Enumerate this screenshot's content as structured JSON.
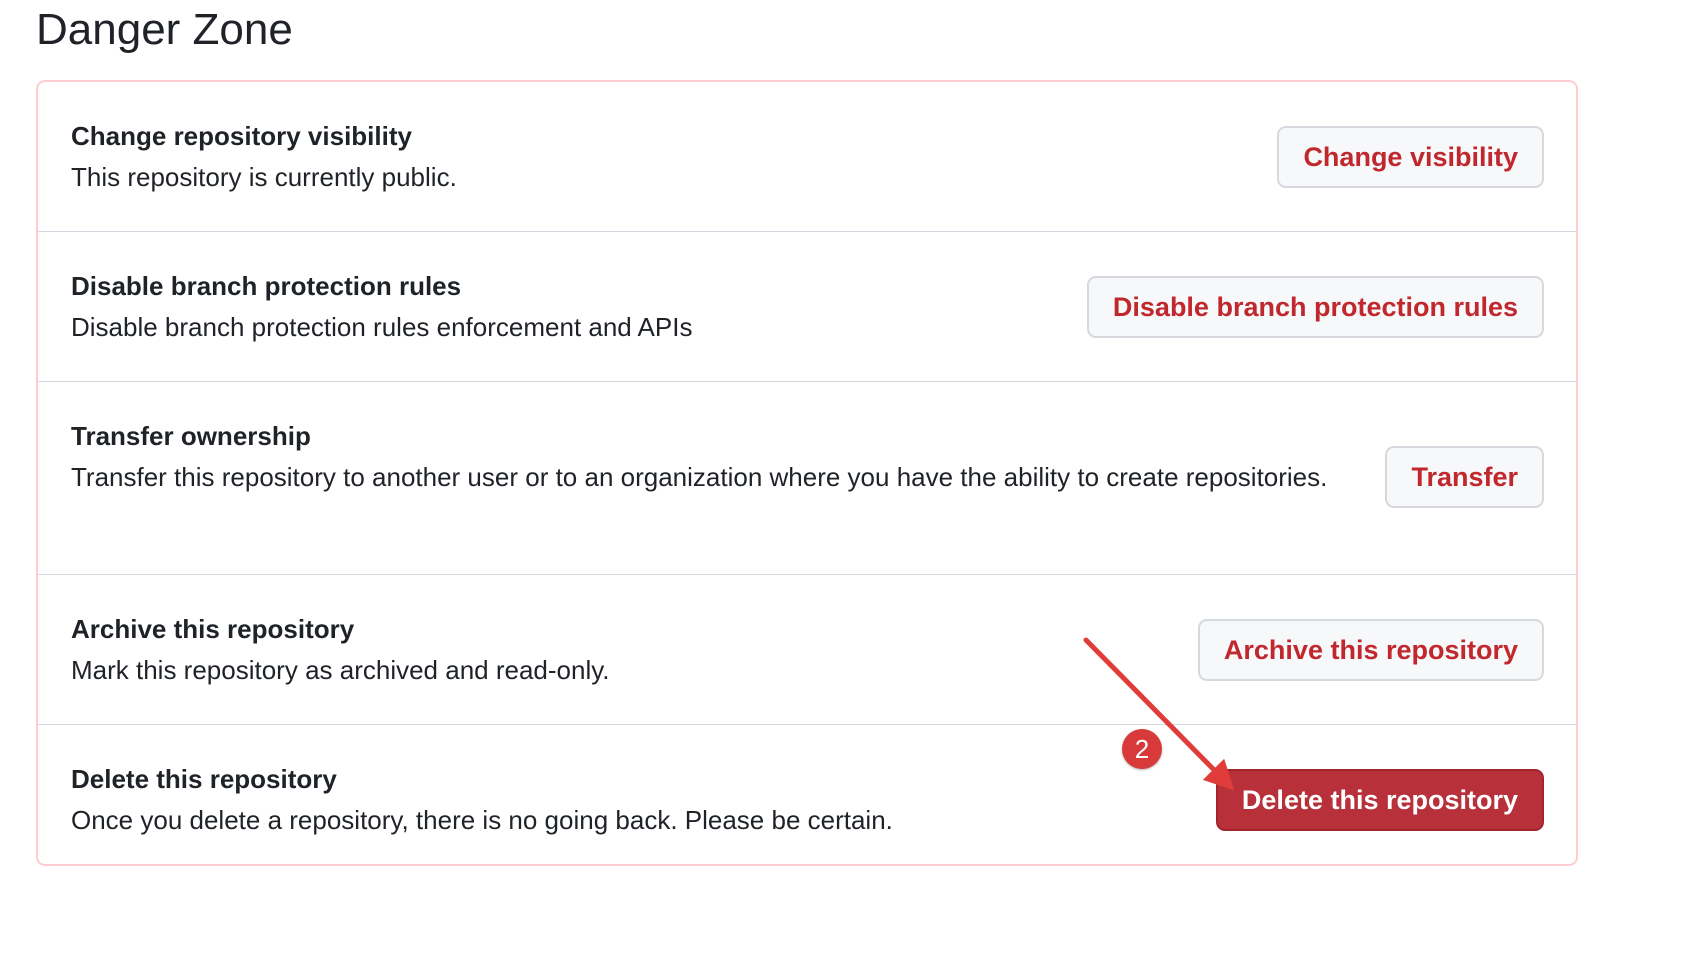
{
  "page_title": "Danger Zone",
  "colors": {
    "danger_text": "#c0282e",
    "danger_button_bg": "#b8303a",
    "box_border": "#ffcdd0",
    "annotation": "#e03c3a"
  },
  "rows": [
    {
      "title": "Change repository visibility",
      "description": "This repository is currently public.",
      "button_label": "Change visibility"
    },
    {
      "title": "Disable branch protection rules",
      "description": "Disable branch protection rules enforcement and APIs",
      "button_label": "Disable branch protection rules"
    },
    {
      "title": "Transfer ownership",
      "description": "Transfer this repository to another user or to an organization where you have the ability to create repositories.",
      "button_label": "Transfer"
    },
    {
      "title": "Archive this repository",
      "description": "Mark this repository as archived and read-only.",
      "button_label": "Archive this repository"
    },
    {
      "title": "Delete this repository",
      "description": "Once you delete a repository, there is no going back. Please be certain.",
      "button_label": "Delete this repository"
    }
  ],
  "annotation": {
    "step_number": "2",
    "arrow_icon": "arrow-icon"
  }
}
